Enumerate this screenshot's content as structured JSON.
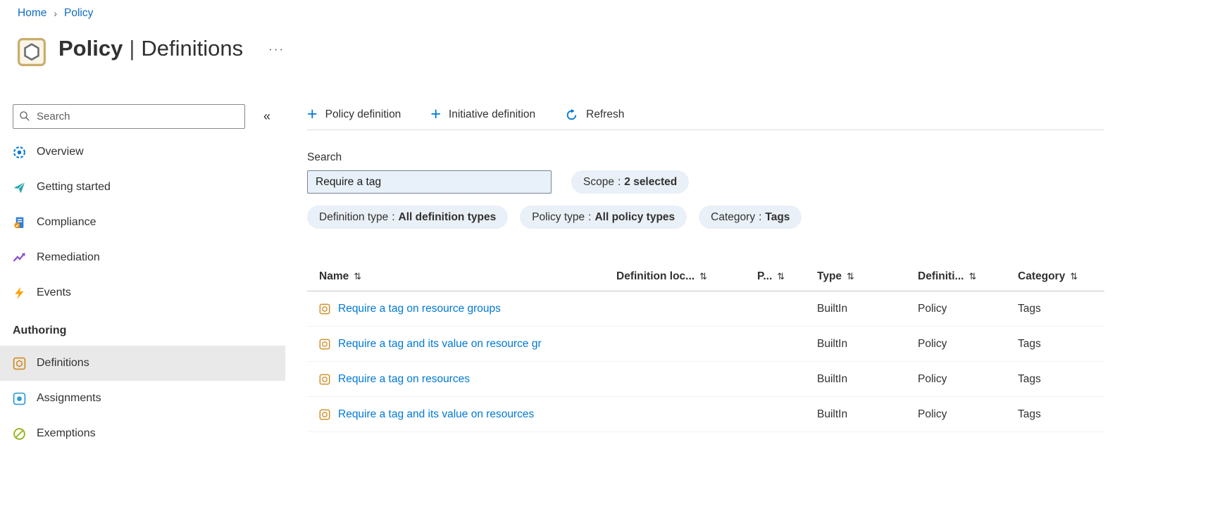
{
  "breadcrumb": {
    "items": [
      "Home",
      "Policy"
    ]
  },
  "header": {
    "title": "Policy",
    "separator": "|",
    "subtitle": "Definitions"
  },
  "icons": {
    "breadcrumb_separator": "›",
    "more": "···",
    "collapse": "«",
    "plus": "+",
    "sort": "⇅"
  },
  "sidebar": {
    "search": {
      "placeholder": "Search"
    },
    "items": [
      {
        "label": "Overview"
      },
      {
        "label": "Getting started"
      },
      {
        "label": "Compliance"
      },
      {
        "label": "Remediation"
      },
      {
        "label": "Events"
      }
    ],
    "section_heading": "Authoring",
    "authoring_items": [
      {
        "label": "Definitions",
        "selected": true
      },
      {
        "label": "Assignments",
        "selected": false
      },
      {
        "label": "Exemptions",
        "selected": false
      }
    ]
  },
  "toolbar": {
    "buttons": [
      {
        "label": "Policy definition"
      },
      {
        "label": "Initiative definition"
      },
      {
        "label": "Refresh"
      }
    ]
  },
  "filters": {
    "search_label": "Search",
    "search_value": "Require a tag",
    "separator": ":",
    "pills": [
      {
        "name": "Scope",
        "value": "2 selected"
      },
      {
        "name": "Definition type",
        "value": "All definition types"
      },
      {
        "name": "Policy type",
        "value": "All policy types"
      },
      {
        "name": "Category",
        "value": "Tags"
      }
    ]
  },
  "table": {
    "sort_icon": "⇅",
    "columns": [
      {
        "label": "Name"
      },
      {
        "label": "Definition loc..."
      },
      {
        "label": "P..."
      },
      {
        "label": "Type"
      },
      {
        "label": "Definiti..."
      },
      {
        "label": "Category"
      }
    ],
    "rows": [
      {
        "name": "Require a tag on resource groups",
        "definition_location": "",
        "policies": "",
        "type": "BuiltIn",
        "definition_type": "Policy",
        "category": "Tags"
      },
      {
        "name": "Require a tag and its value on resource gr",
        "definition_location": "",
        "policies": "",
        "type": "BuiltIn",
        "definition_type": "Policy",
        "category": "Tags"
      },
      {
        "name": "Require a tag on resources",
        "definition_location": "",
        "policies": "",
        "type": "BuiltIn",
        "definition_type": "Policy",
        "category": "Tags"
      },
      {
        "name": "Require a tag and its value on resources",
        "definition_location": "",
        "policies": "",
        "type": "BuiltIn",
        "definition_type": "Policy",
        "category": "Tags"
      }
    ]
  },
  "colors": {
    "accent": "#0078d4",
    "link": "#0078d4",
    "breadcrumb_link": "#0f6cbd",
    "selected_item_background": "#e9e9e9",
    "pill_background": "#e9f0f7",
    "search_value_background": "#e8f1fa",
    "definition_icon": "#cf8a1f"
  }
}
